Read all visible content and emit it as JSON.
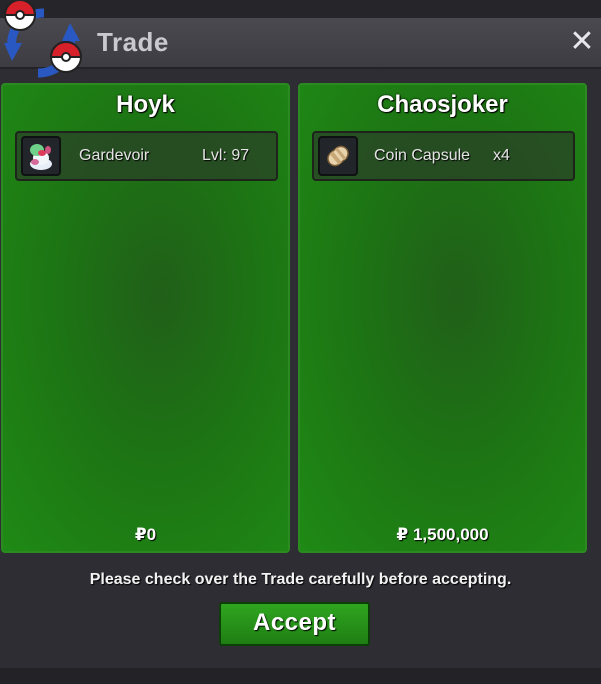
{
  "window": {
    "title": "Trade",
    "close_symbol": "✕"
  },
  "left_panel": {
    "player_name": "Hoyk",
    "item": {
      "icon": "gardevoir-sprite",
      "name": "Gardevoir",
      "level_text": "Lvl: 97"
    },
    "money": "₽0"
  },
  "right_panel": {
    "player_name": "Chaosjoker",
    "item": {
      "icon": "coin-capsule-icon",
      "name": "Coin Capsule",
      "quantity": "x4"
    },
    "money": "₽ 1,500,000"
  },
  "footer": {
    "message": "Please check over the Trade carefully before accepting.",
    "accept_label": "Accept"
  },
  "colors": {
    "panel_green": "#1f8a15",
    "accent_green": "#2fa61f",
    "titlebar": "#45444a"
  }
}
